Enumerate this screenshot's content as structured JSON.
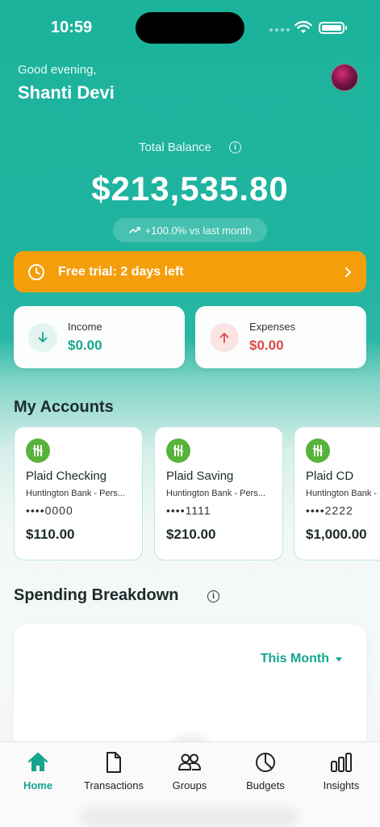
{
  "status_bar": {
    "time": "10:59"
  },
  "header": {
    "greeting": "Good evening,",
    "user_name": "Shanti Devi"
  },
  "balance": {
    "label": "Total Balance",
    "info_icon": "i",
    "amount": "$213,535.80",
    "change": "+100.0% vs last month"
  },
  "trial_banner": {
    "text": "Free trial: 2 days left"
  },
  "summary": {
    "income": {
      "label": "Income",
      "value": "$0.00",
      "color": "#16a58e"
    },
    "expenses": {
      "label": "Expenses",
      "value": "$0.00",
      "color": "#e04848"
    }
  },
  "accounts": {
    "title": "My Accounts",
    "items": [
      {
        "name": "Plaid Checking",
        "bank": "Huntington Bank - Pers...",
        "mask": "••••0000",
        "balance": "$110.00"
      },
      {
        "name": "Plaid Saving",
        "bank": "Huntington Bank - Pers...",
        "mask": "••••1111",
        "balance": "$210.00"
      },
      {
        "name": "Plaid CD",
        "bank": "Huntington Bank -",
        "mask": "••••2222",
        "balance": "$1,000.00"
      }
    ]
  },
  "spending": {
    "title": "Spending Breakdown",
    "info_icon": "i",
    "period": "This Month"
  },
  "nav": {
    "items": [
      {
        "label": "Home",
        "icon": "home-icon",
        "active": true
      },
      {
        "label": "Transactions",
        "icon": "document-icon"
      },
      {
        "label": "Groups",
        "icon": "group-icon"
      },
      {
        "label": "Budgets",
        "icon": "pie-chart-icon"
      },
      {
        "label": "Insights",
        "icon": "bar-chart-icon"
      }
    ],
    "accent": "#15a58f"
  }
}
